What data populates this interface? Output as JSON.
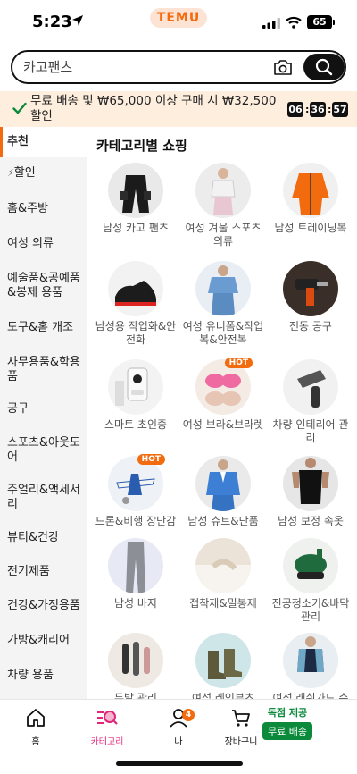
{
  "status_bar": {
    "time": "5:23",
    "brand": "TEMU",
    "battery": "65"
  },
  "search": {
    "placeholder": "카고팬츠"
  },
  "promo": {
    "text": "무료 배송 및 ₩65,000 이상 구매 시 ₩32,500 할인",
    "timer": {
      "hours": "06",
      "minutes": "36",
      "seconds": "57"
    }
  },
  "sidebar": {
    "items": [
      {
        "label": "추천",
        "active": true
      },
      {
        "label": "할인",
        "icon": "lightning-icon"
      },
      {
        "label": "홈&주방"
      },
      {
        "label": "여성 의류"
      },
      {
        "label": "예술품&공예품&봉제 용품"
      },
      {
        "label": "도구&홈 개조"
      },
      {
        "label": "사무용품&학용품"
      },
      {
        "label": "공구"
      },
      {
        "label": "스포츠&아웃도어"
      },
      {
        "label": "주얼리&액세서리"
      },
      {
        "label": "뷰티&건강"
      },
      {
        "label": "전기제품"
      },
      {
        "label": "건강&가정용품"
      },
      {
        "label": "가방&캐리어"
      },
      {
        "label": "차량 용품"
      }
    ]
  },
  "main": {
    "title": "카테고리별 쇼핑",
    "categories": [
      {
        "label": "남성 카고 팬츠"
      },
      {
        "label": "여성 겨울 스포츠 의류"
      },
      {
        "label": "남성 트레이닝복"
      },
      {
        "label": "남성용 작업화&안전화"
      },
      {
        "label": "여성 유니폼&작업복&안전복"
      },
      {
        "label": "전동 공구"
      },
      {
        "label": "스마트 초인종"
      },
      {
        "label": "여성 브라&브라렛",
        "badge": "HOT"
      },
      {
        "label": "차량 인테리어 관리"
      },
      {
        "label": "드론&비행 장난감",
        "badge": "HOT"
      },
      {
        "label": "남성 슈트&단품"
      },
      {
        "label": "남성 보정 속옷"
      },
      {
        "label": "남성 바지"
      },
      {
        "label": "접착제&밀봉제"
      },
      {
        "label": "진공청소기&바닥 관리"
      },
      {
        "label": "두발 관리"
      },
      {
        "label": "여성 레인부츠"
      },
      {
        "label": "여성 래쉬가드 수"
      }
    ]
  },
  "bottom_nav": {
    "home": "홈",
    "categories": "카테고리",
    "me": "나",
    "me_badge": "4",
    "cart": "장바구니",
    "offer_top": "독점 제공",
    "offer_button": "무료 배송"
  },
  "colors": {
    "accent": "#f26b0f",
    "nav_active": "#e0267a",
    "offer_green": "#0a8a3a",
    "promo_bg": "#fdeede"
  }
}
